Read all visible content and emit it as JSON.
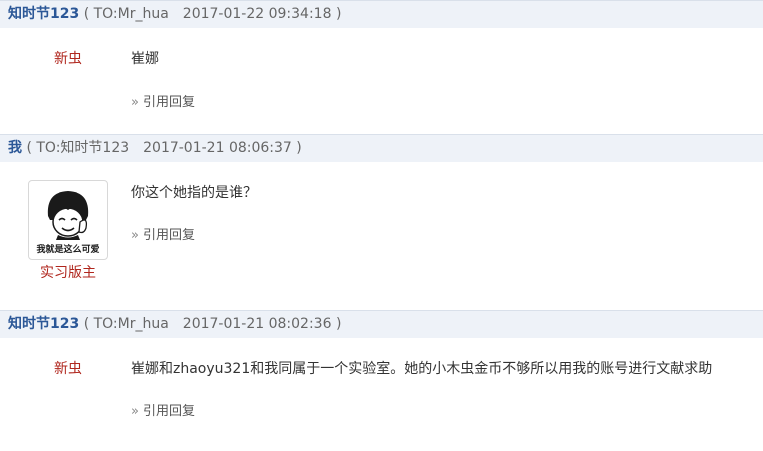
{
  "posts": [
    {
      "author": "知时节123",
      "meta": "( TO:Mr_hua　2017-01-22 09:34:18 )",
      "rank": "新虫",
      "content": "崔娜",
      "reply_label": "引用回复"
    },
    {
      "author": "我",
      "meta": "( TO:知时节123　2017-01-21 08:06:37 )",
      "avatar_caption": "我就是这么可爱",
      "rank": "实习版主",
      "content": "你这个她指的是谁？",
      "reply_label": "引用回复"
    },
    {
      "author": "知时节123",
      "meta": "( TO:Mr_hua　2017-01-21 08:02:36 )",
      "rank": "新虫",
      "content": "崔娜和zhaoyu321和我同属于一个实验室。她的小木虫金币不够所以用我的账号进行文献求助",
      "reply_label": "引用回复"
    }
  ],
  "reply_arrow": "»",
  "colors": {
    "header_bg": "#eef2f8",
    "author": "#2b5797",
    "rank": "#b0261d"
  }
}
